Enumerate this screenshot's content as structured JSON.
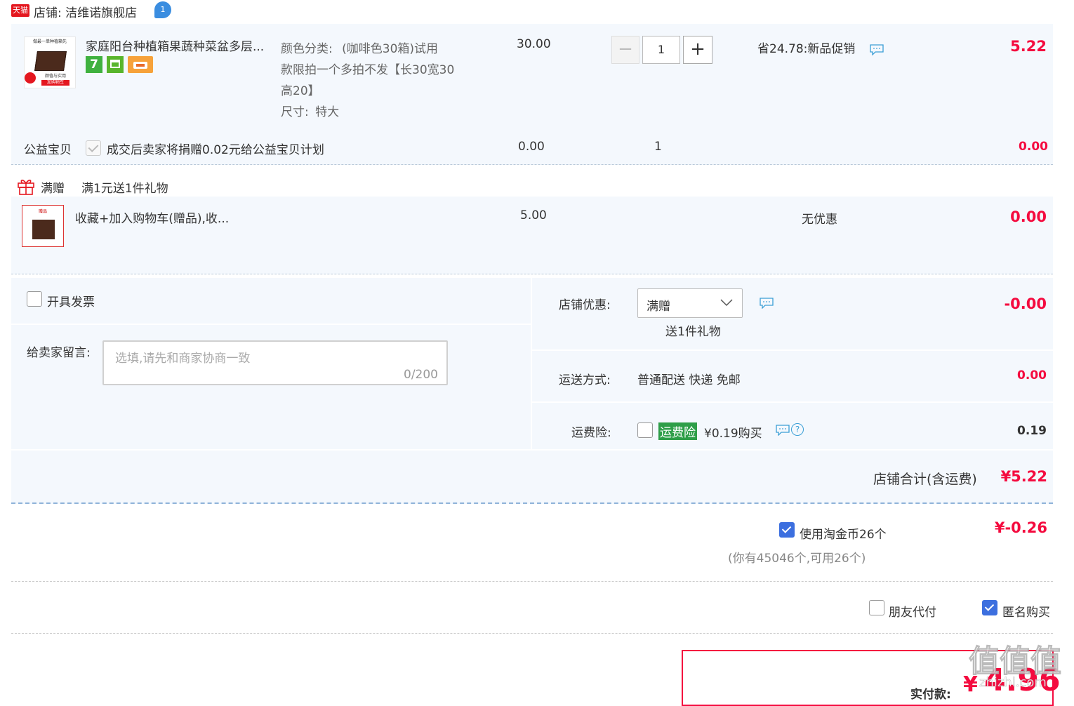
{
  "shop": {
    "badge": "天猫",
    "label": "店铺: 洁维诺旗舰店",
    "ww_badge": "1"
  },
  "item": {
    "image_caption_top": "做最一单种植箱先",
    "image_caption_mid": "颜值与实用",
    "image_caption_bottom": "加购物车",
    "title": "家庭阳台种植箱果蔬种菜盆多层...",
    "sku_color_label": "颜色分类:",
    "sku_color_value_1": "(咖啡色30箱)试用",
    "sku_color_value_2": "款限拍一个多拍不发【长30宽30",
    "sku_color_value_3": "高20】",
    "sku_size_label": "尺寸:",
    "sku_size_value": "特大",
    "price": "30.00",
    "quantity": "1",
    "promo": "省24.78:新品促销",
    "subtotal": "5.22",
    "icons": [
      "seven-day-return-icon",
      "service-guarantee-icon",
      "credit-card-icon"
    ],
    "seven_label": "7"
  },
  "charity": {
    "label": "公益宝贝",
    "text": "成交后卖家将捐赠0.02元给公益宝贝计划",
    "price": "0.00",
    "quantity": "1",
    "subtotal": "0.00"
  },
  "gift": {
    "tag": "满赠",
    "rule": "满1元送1件礼物",
    "title": "收藏+加入购物车(赠品),收...",
    "image_caption": "赠品",
    "price": "5.00",
    "promo": "无优惠",
    "subtotal": "0.00"
  },
  "invoice": {
    "label": "开具发票"
  },
  "message": {
    "label": "给卖家留言:",
    "placeholder": "选填,请先和商家协商一致",
    "counter": "0/200"
  },
  "shop_discount": {
    "label": "店铺优惠:",
    "selected": "满赠",
    "desc": "送1件礼物",
    "amount": "-0.00"
  },
  "delivery": {
    "label": "运送方式:",
    "value": "普通配送 快递 免邮",
    "amount": "0.00"
  },
  "insurance": {
    "label": "运费险:",
    "tag": "运费险",
    "text": "¥0.19购买",
    "amount": "0.19"
  },
  "shop_total": {
    "label": "店铺合计(含运费)",
    "amount": "¥5.22"
  },
  "coins": {
    "label": "使用淘金币26个",
    "amount": "¥-0.26",
    "note": "(你有45046个,可用26个)"
  },
  "options": {
    "friend_pay": "朋友代付",
    "anonymous": "匿名购买"
  },
  "pay": {
    "label": "实付款:",
    "currency": "¥",
    "amount": "4.96"
  },
  "watermark": {
    "brand": "值值值",
    "site": "zhizhi.com"
  },
  "colors": {
    "accent_red": "#f40b3f",
    "row_bg": "#f4f8fd",
    "check_blue": "#3c6fdf",
    "insurance_green": "#2e9e48"
  }
}
